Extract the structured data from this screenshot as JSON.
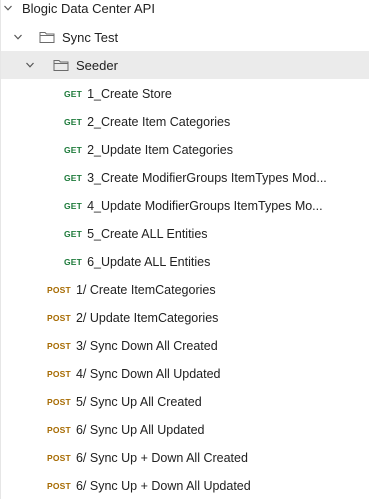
{
  "collection": {
    "name": "Blogic Data Center API",
    "expanded": true
  },
  "folders": {
    "sync_test": {
      "name": "Sync Test",
      "expanded": true
    },
    "seeder": {
      "name": "Seeder",
      "expanded": true,
      "selected": true
    }
  },
  "seeder_requests": [
    {
      "method": "GET",
      "name": "1_Create Store"
    },
    {
      "method": "GET",
      "name": "2_Create Item Categories"
    },
    {
      "method": "GET",
      "name": "2_Update Item Categories"
    },
    {
      "method": "GET",
      "name": "3_Create ModifierGroups ItemTypes Mod..."
    },
    {
      "method": "GET",
      "name": "4_Update ModifierGroups ItemTypes Mo..."
    },
    {
      "method": "GET",
      "name": "5_Create ALL Entities"
    },
    {
      "method": "GET",
      "name": "6_Update ALL Entities"
    }
  ],
  "sync_requests": [
    {
      "method": "POST",
      "name": "1/ Create ItemCategories"
    },
    {
      "method": "POST",
      "name": "2/ Update ItemCategories"
    },
    {
      "method": "POST",
      "name": "3/ Sync Down All Created"
    },
    {
      "method": "POST",
      "name": "4/ Sync Down All Updated"
    },
    {
      "method": "POST",
      "name": "5/ Sync Up All Created"
    },
    {
      "method": "POST",
      "name": "6/ Sync Up All Updated"
    },
    {
      "method": "POST",
      "name": "6/ Sync Up + Down All Created"
    },
    {
      "method": "POST",
      "name": "6/ Sync Up + Down All Updated"
    }
  ],
  "colors": {
    "get_method": "#1d7a3a",
    "post_method": "#a66a00",
    "selected_row_bg": "#ebebeb"
  },
  "icons": {
    "expand": "chevron-down-icon",
    "folder": "folder-icon"
  }
}
